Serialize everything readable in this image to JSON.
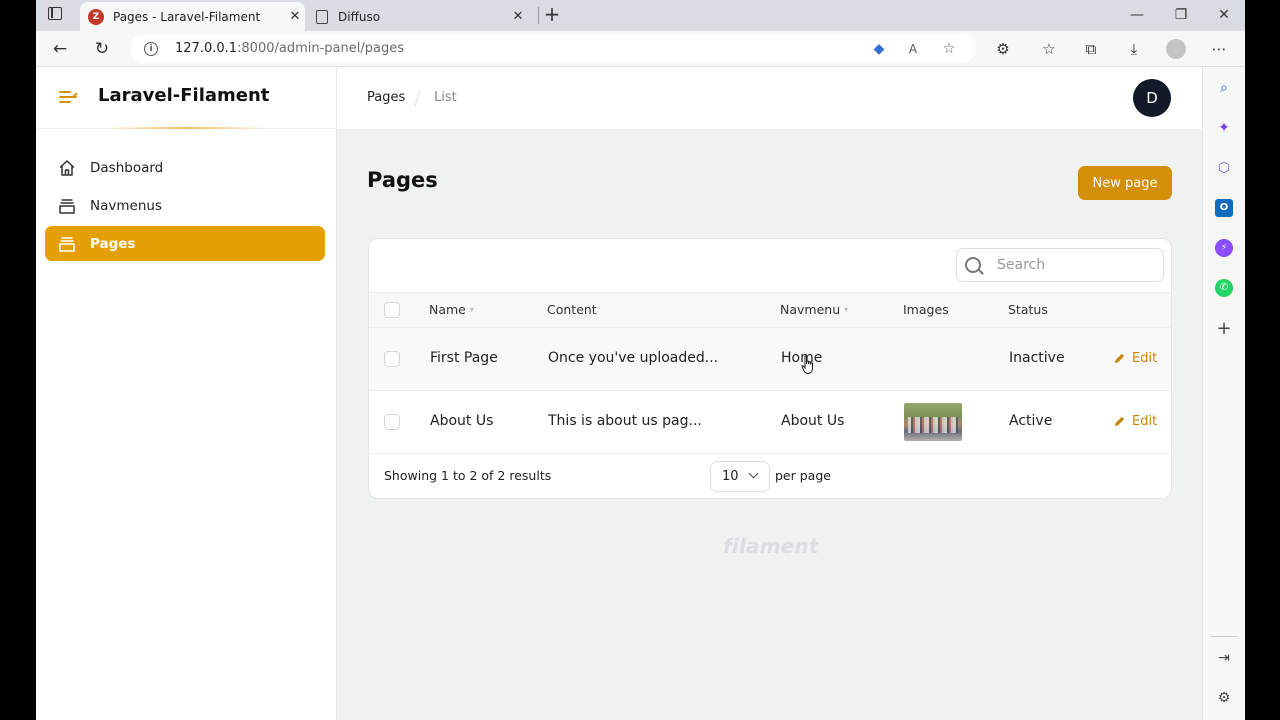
{
  "browser": {
    "tabs": [
      {
        "title": "Pages - Laravel-Filament",
        "favicon": "laravel-filament-favicon-icon"
      },
      {
        "title": "Diffuso",
        "favicon": "document-icon"
      }
    ],
    "url": {
      "host": "127.0.0.1",
      "path": ":8000/admin-panel/pages"
    }
  },
  "app": {
    "brand": "Laravel-Filament",
    "accent_color": "#e6a007",
    "sidebar": {
      "items": [
        {
          "label": "Dashboard",
          "icon": "home-icon",
          "active": false
        },
        {
          "label": "Navmenus",
          "icon": "archive-box-icon",
          "active": false
        },
        {
          "label": "Pages",
          "icon": "archive-box-icon",
          "active": true
        }
      ]
    },
    "breadcrumbs": [
      "Pages",
      "List"
    ],
    "user_initial": "D",
    "page": {
      "title": "Pages",
      "new_button": "New page"
    },
    "table": {
      "search_placeholder": "Search",
      "columns": [
        "Name",
        "Content",
        "Navmenu",
        "Images",
        "Status"
      ],
      "rows": [
        {
          "name": "First Page",
          "content": "Once you've uploaded...",
          "navmenu": "Home",
          "has_image": false,
          "status": "Inactive",
          "action": "Edit"
        },
        {
          "name": "About Us",
          "content": "This is about us pag...",
          "navmenu": "About Us",
          "has_image": true,
          "status": "Active",
          "action": "Edit"
        }
      ],
      "footer": {
        "showing": "Showing 1 to 2 of 2 results",
        "per_page_value": "10",
        "per_page_label": "per page"
      }
    },
    "footer_logo": "filament"
  }
}
